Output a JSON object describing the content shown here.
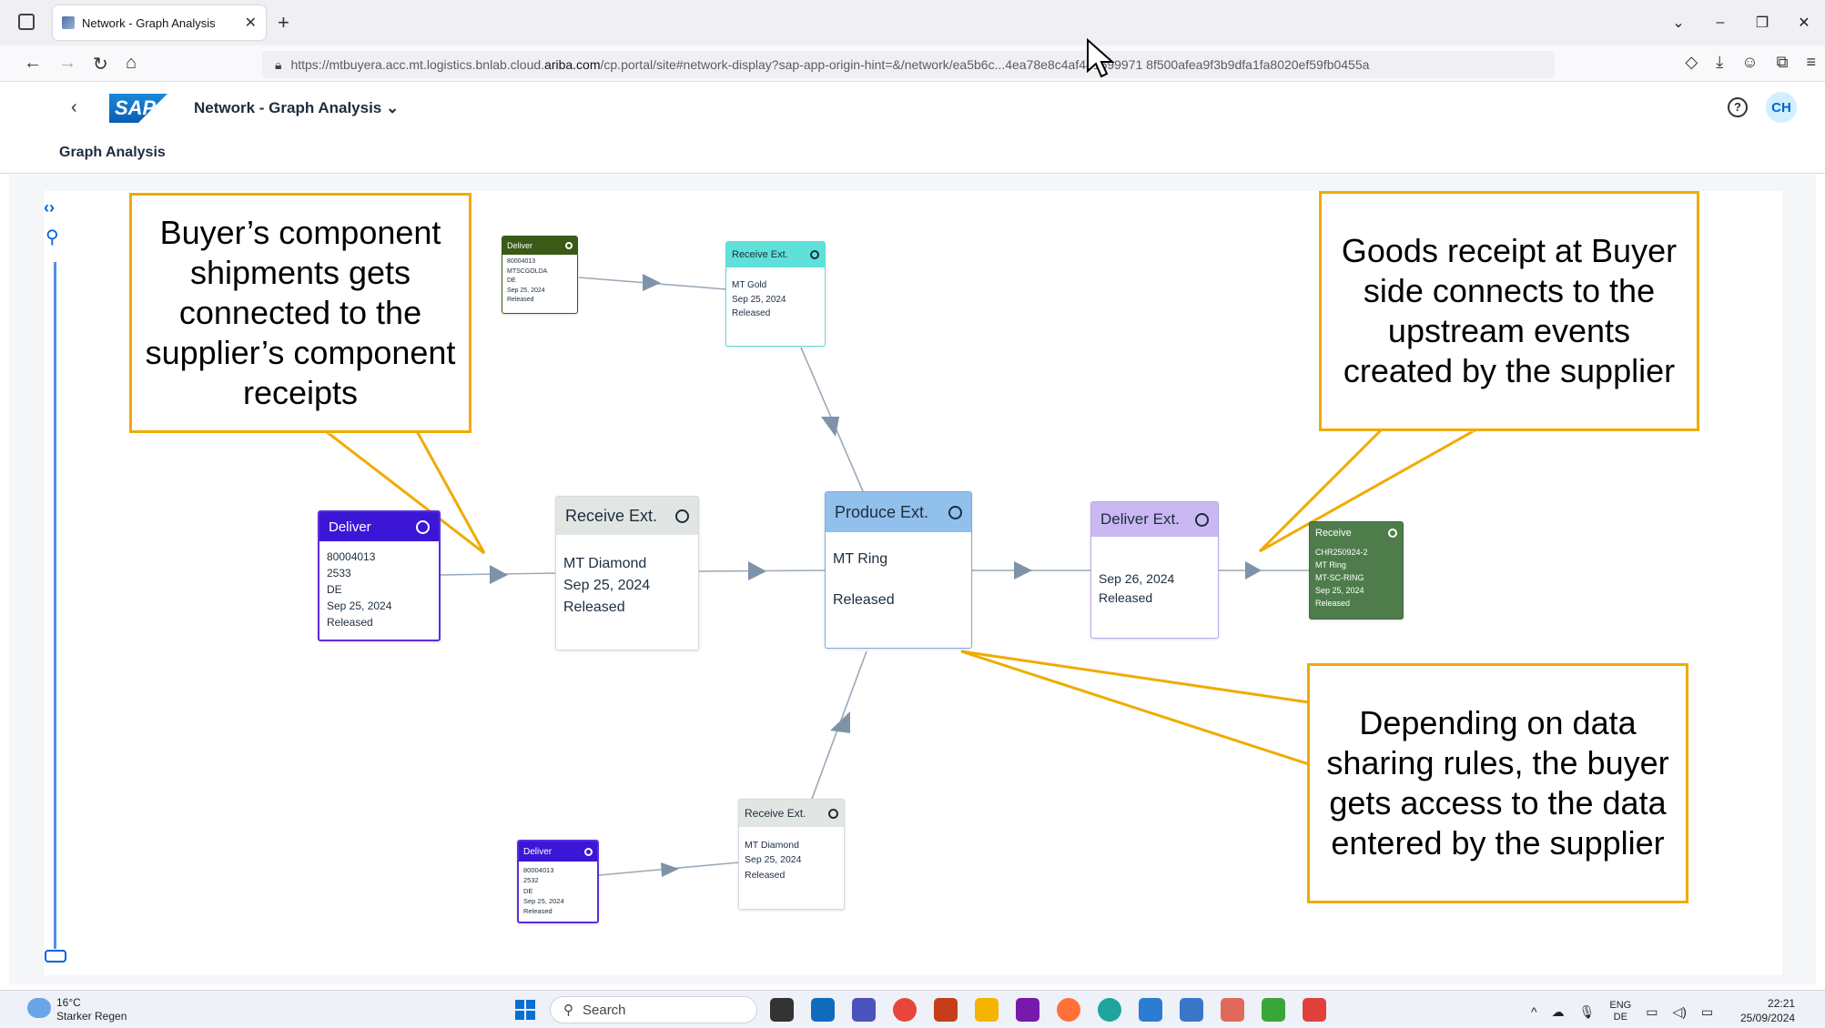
{
  "browser": {
    "tab_title": "Network - Graph Analysis",
    "tab_close": "✕",
    "new_tab": "+",
    "url_prefix": "https://mtbuyera.acc.mt.logistics.bnlab.cloud.",
    "url_domain": "ariba.com",
    "url_suffix": "/cp.portal/site#network-display?sap-app-origin-hint=&/network/ea5b6c...4ea78e8c4af441699971 8f500afea9f3b9dfa1fa8020ef59fb0455a"
  },
  "shell": {
    "logo": "SAP",
    "app_title": "Network - Graph Analysis",
    "app_title_chevron": "⌄",
    "help": "?",
    "user_initials": "CH"
  },
  "page": {
    "title": "Graph Analysis"
  },
  "nodes": {
    "deliver_main": {
      "title": "Deliver",
      "lines": [
        "80004013",
        "2533",
        "DE",
        "Sep 25, 2024",
        "Released"
      ]
    },
    "receive_diamond": {
      "title": "Receive Ext.",
      "lines": [
        "MT Diamond",
        "Sep 25, 2024",
        "Released"
      ]
    },
    "produce": {
      "title": "Produce Ext.",
      "lines": [
        "MT Ring",
        "",
        "Released"
      ]
    },
    "deliver_ext": {
      "title": "Deliver Ext.",
      "lines": [
        "Sep 26, 2024",
        "Released"
      ]
    },
    "receive_final": {
      "title": "Receive",
      "lines": [
        "CHR250924-2",
        "MT Ring",
        "MT-SC-RING",
        "Sep 25, 2024",
        "Released"
      ]
    },
    "deliver_gold": {
      "title": "Deliver",
      "lines": [
        "80004013",
        "MTSCGOLDA",
        "DE",
        "Sep 25, 2024",
        "Released"
      ]
    },
    "receive_gold": {
      "title": "Receive Ext.",
      "lines": [
        "MT Gold",
        "Sep 25, 2024",
        "Released"
      ]
    },
    "deliver_small": {
      "title": "Deliver",
      "lines": [
        "80004013",
        "2532",
        "DE",
        "Sep 25, 2024",
        "Released"
      ]
    },
    "receive_diamond2": {
      "title": "Receive Ext.",
      "lines": [
        "MT Diamond",
        "Sep 25, 2024",
        "Released"
      ]
    }
  },
  "callouts": {
    "left": "Buyer’s component shipments gets connected to the supplier’s component receipts",
    "right_top": "Goods receipt at Buyer side connects to the upstream events created by the supplier",
    "right_bottom": "Depending on data sharing rules, the buyer gets access to the data entered by the supplier"
  },
  "taskbar": {
    "temperature": "16°C",
    "weather": "Starker Regen",
    "search_placeholder": "Search",
    "lang_top": "ENG",
    "lang_bottom": "DE",
    "time": "22:21",
    "date": "25/09/2024"
  },
  "colors": {
    "callout_border": "#f0ab00",
    "sap_blue": "#0064d9",
    "deliver_purple": "#3c16d6",
    "receive_green": "#4e7d4b",
    "gold_green": "#3a5a16",
    "teal": "#5fe0d8",
    "produce_blue": "#92c0ec",
    "deliver_ext_lilac": "#c9b8f2"
  }
}
